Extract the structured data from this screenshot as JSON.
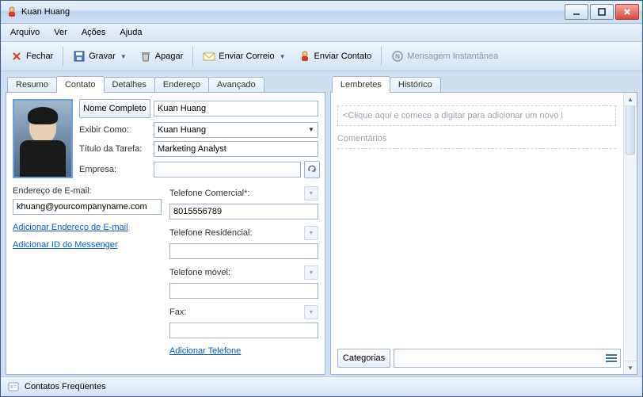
{
  "title": "Kuan Huang",
  "menu": {
    "arquivo": "Arquivo",
    "ver": "Ver",
    "acoes": "Ações",
    "ajuda": "Ajuda"
  },
  "toolbar": {
    "fechar": "Fechar",
    "gravar": "Gravar",
    "apagar": "Apagar",
    "enviar_correio": "Enviar Correio",
    "enviar_contato": "Enviar Contato",
    "mensagem_instantanea": "Mensagem Instantânea"
  },
  "left_tabs": {
    "resumo": "Resumo",
    "contato": "Contato",
    "detalhes": "Detalhes",
    "endereco": "Endereço",
    "avancado": "Avançado"
  },
  "form": {
    "nome_completo_btn": "Nome Completo",
    "nome_completo_value": "Kuan Huang",
    "exibir_como_label": "Exibir Como:",
    "exibir_como_value": "Kuan Huang",
    "titulo_label": "Título da Tarefa:",
    "titulo_value": "Marketing Analyst",
    "empresa_label": "Empresa:",
    "empresa_value": "",
    "email_label": "Endereço de E-mail:",
    "email_value": "khuang@yourcompanyname.com",
    "add_email_link": "Adicionar Endereço de E-mail",
    "add_messenger_link": "Adicionar ID do Messenger",
    "tel_comercial_label": "Telefone Comercial*:",
    "tel_comercial_value": "8015556789",
    "tel_residencial_label": "Telefone Residencial:",
    "tel_residencial_value": "",
    "tel_movel_label": "Telefone móvel:",
    "tel_movel_value": "",
    "fax_label": "Fax:",
    "fax_value": "",
    "add_phone_link": "Adicionar Telefone"
  },
  "right_tabs": {
    "lembretes": "Lembretes",
    "historico": "Histórico"
  },
  "reminders": {
    "placeholder": "<Clique aqui e comece a digitar para adicionar um novo l",
    "comments_label": "Comentários"
  },
  "categories_btn": "Categorias",
  "status": "Contatos Freqüentes"
}
